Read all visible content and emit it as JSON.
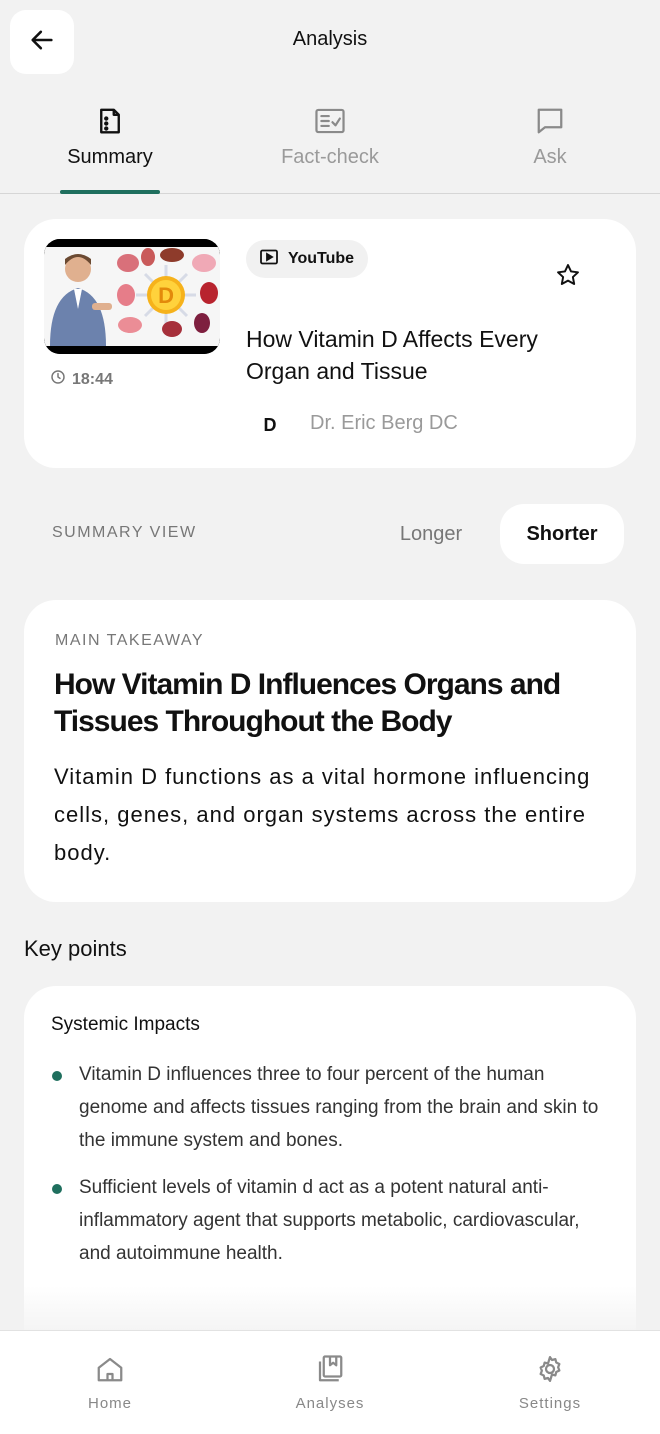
{
  "header": {
    "title": "Analysis",
    "back_icon": "arrow-left-icon"
  },
  "tabs": [
    {
      "label": "Summary",
      "icon": "document-icon",
      "active": true
    },
    {
      "label": "Fact-check",
      "icon": "checklist-icon",
      "active": false
    },
    {
      "label": "Ask",
      "icon": "chat-icon",
      "active": false
    }
  ],
  "video": {
    "source": "YouTube",
    "duration": "18:44",
    "title": "How Vitamin D Affects Every Organ and Tissue",
    "channel_initial": "D",
    "channel": "Dr. Eric Berg DC",
    "thumbnail_letter": "D"
  },
  "summary_view": {
    "label": "SUMMARY VIEW",
    "options": [
      "Longer",
      "Shorter"
    ],
    "selected": "Shorter"
  },
  "takeaway": {
    "kicker": "MAIN TAKEAWAY",
    "title": "How Vitamin D Influences Organs and Tissues Throughout the Body",
    "body": "Vitamin D functions as a vital hormone influencing cells, genes, and organ systems across the entire body."
  },
  "key_points": {
    "title": "Key points",
    "sections": [
      {
        "heading": "Systemic Impacts",
        "items": [
          "Vitamin D influences three to four percent of the human genome and affects tissues ranging from the brain and skin to the immune system and bones.",
          "Sufficient levels of vitamin d act as a potent natural anti-inflammatory agent that supports metabolic, cardiovascular, and autoimmune health."
        ]
      }
    ]
  },
  "bottom_nav": [
    {
      "label": "Home",
      "icon": "home-icon"
    },
    {
      "label": "Analyses",
      "icon": "bookmark-stack-icon"
    },
    {
      "label": "Settings",
      "icon": "gear-icon"
    }
  ],
  "colors": {
    "accent": "#1f6f5e",
    "background": "#f2f2f2"
  }
}
